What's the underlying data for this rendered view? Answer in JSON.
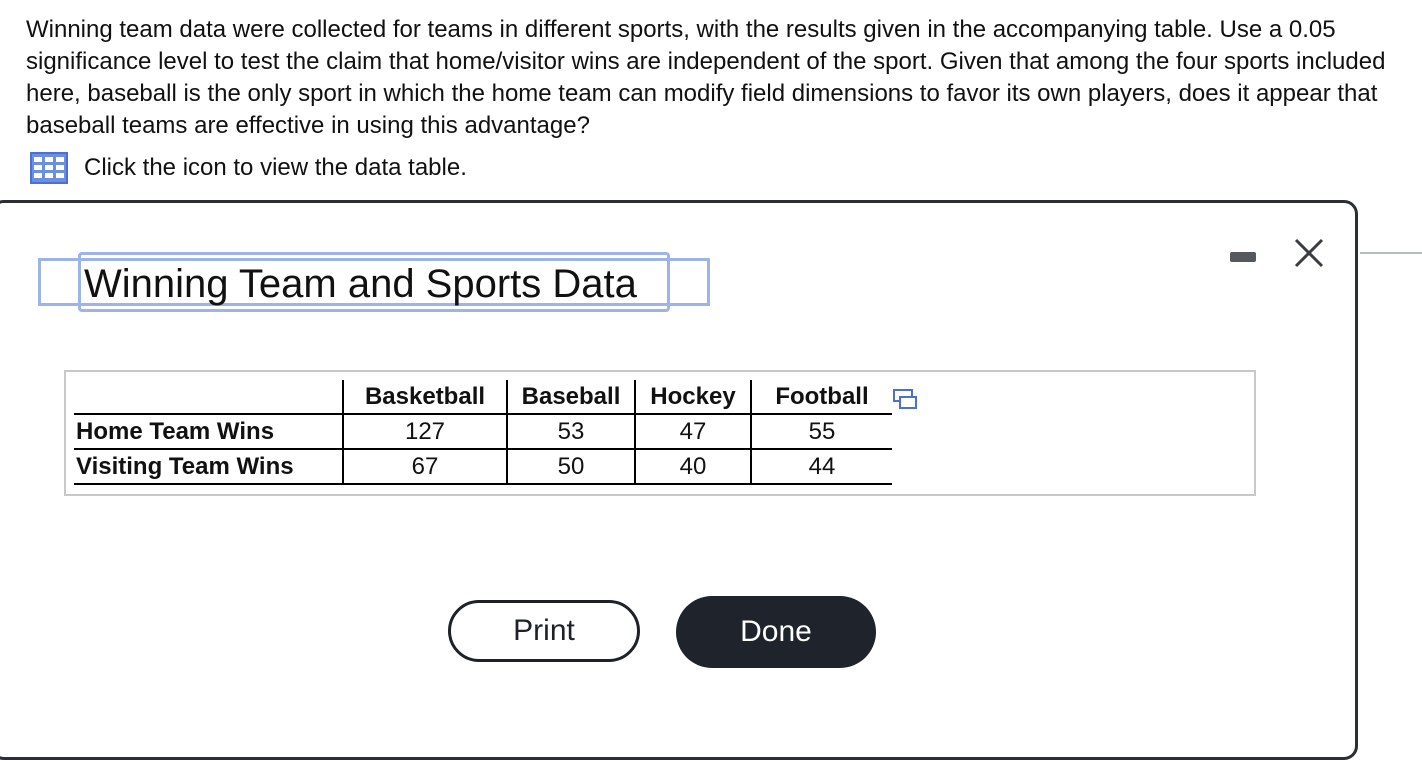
{
  "question": {
    "text": "Winning team data were collected for teams in different sports, with the results given in the accompanying table. Use a 0.05 significance level to test the claim that home/visitor wins are independent of the sport. Given that among the four sports included here, baseball is the only sport in which the home team can modify field dimensions to favor its own players, does it appear that baseball teams are effective in using this advantage?",
    "data_link": "Click the icon to view the data table.",
    "data_link_icon": "table-grid-icon"
  },
  "modal": {
    "title": "Winning Team and Sports Data",
    "minimize_icon": "minimize-icon",
    "close_icon": "close-icon",
    "table": {
      "columns": [
        "Basketball",
        "Baseball",
        "Hockey",
        "Football"
      ],
      "rows": [
        {
          "label": "Home Team Wins",
          "values": [
            "127",
            "53",
            "47",
            "55"
          ]
        },
        {
          "label": "Visiting Team Wins",
          "values": [
            "67",
            "50",
            "40",
            "44"
          ]
        }
      ],
      "copy_icon": "copy-icon"
    },
    "buttons": {
      "print": "Print",
      "done": "Done"
    }
  },
  "colors": {
    "accent_frame": "#9db4e8",
    "icon_blue": "#4a6fd6",
    "done_bg": "#1f232b"
  }
}
